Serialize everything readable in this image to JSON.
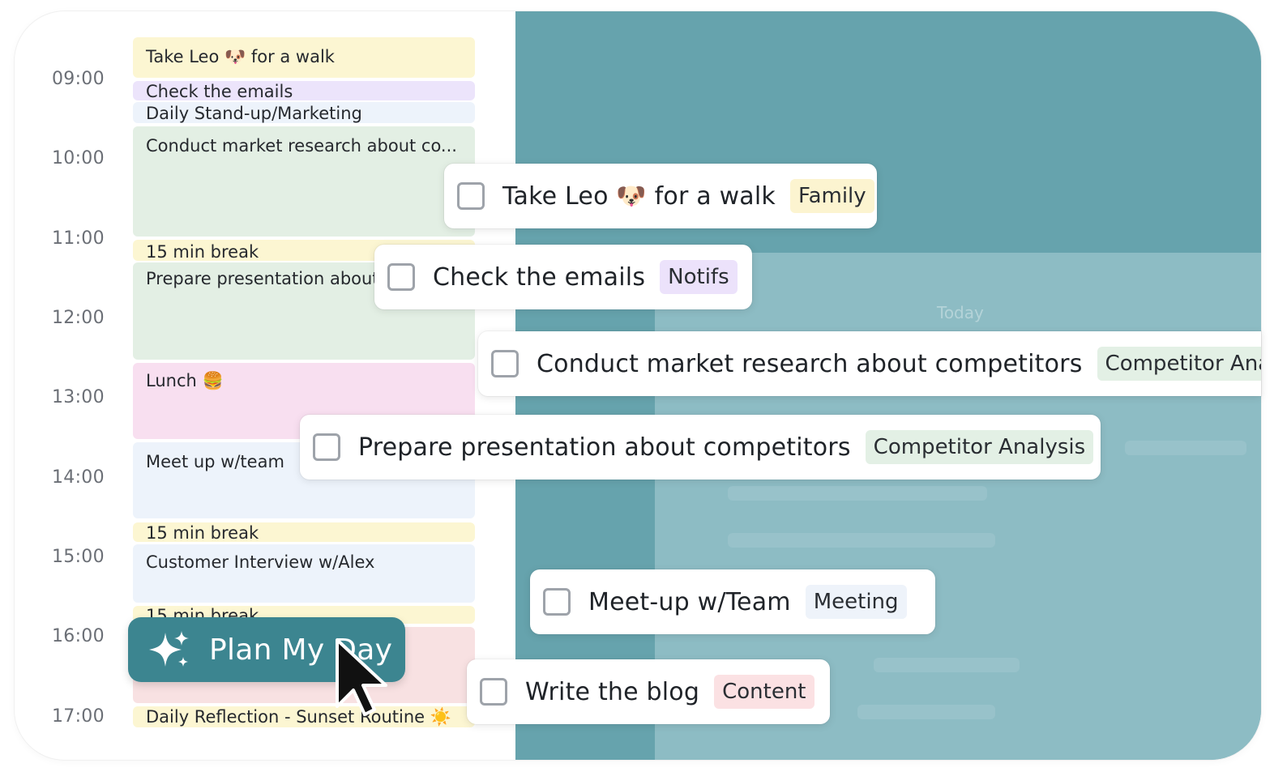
{
  "times": [
    "09:00",
    "10:00",
    "11:00",
    "12:00",
    "13:00",
    "14:00",
    "15:00",
    "16:00",
    "17:00"
  ],
  "events": {
    "leo": "Take Leo 🐶 for a walk",
    "emails": "Check the emails",
    "standup": "Daily Stand-up/Marketing",
    "research": "Conduct market research about co...",
    "break1": "15 min break",
    "presentation": "Prepare presentation about competitors",
    "lunch": "Lunch 🍔",
    "meetup": "Meet up w/team",
    "break2": "15 min break",
    "interview": "Customer Interview w/Alex",
    "break3": "15 min break",
    "reflection": "Daily Reflection - Sunset Routine ☀️"
  },
  "panel": {
    "today": "Today"
  },
  "tasks": [
    {
      "title": "Take Leo 🐶 for a walk",
      "tag": "Family",
      "checked": false
    },
    {
      "title": "Check the emails",
      "tag": "Notifs",
      "checked": false
    },
    {
      "title": "Conduct market research about competitors",
      "tag": "Competitor Analysis",
      "checked": false
    },
    {
      "title": "Prepare presentation about competitors",
      "tag": "Competitor Analysis",
      "checked": false
    },
    {
      "title": "Meet-up w/Team",
      "tag": "Meeting",
      "checked": false
    },
    {
      "title": "Write the blog",
      "tag": "Content",
      "checked": false
    }
  ],
  "plan_button": {
    "label": "Plan My Day"
  },
  "icons": {
    "sparkle": "sparkle-icon",
    "cursor": "cursor-icon"
  },
  "colors": {
    "teal": "#66a3ad",
    "teal_light": "#8dbcc4",
    "button": "#3c8590"
  }
}
